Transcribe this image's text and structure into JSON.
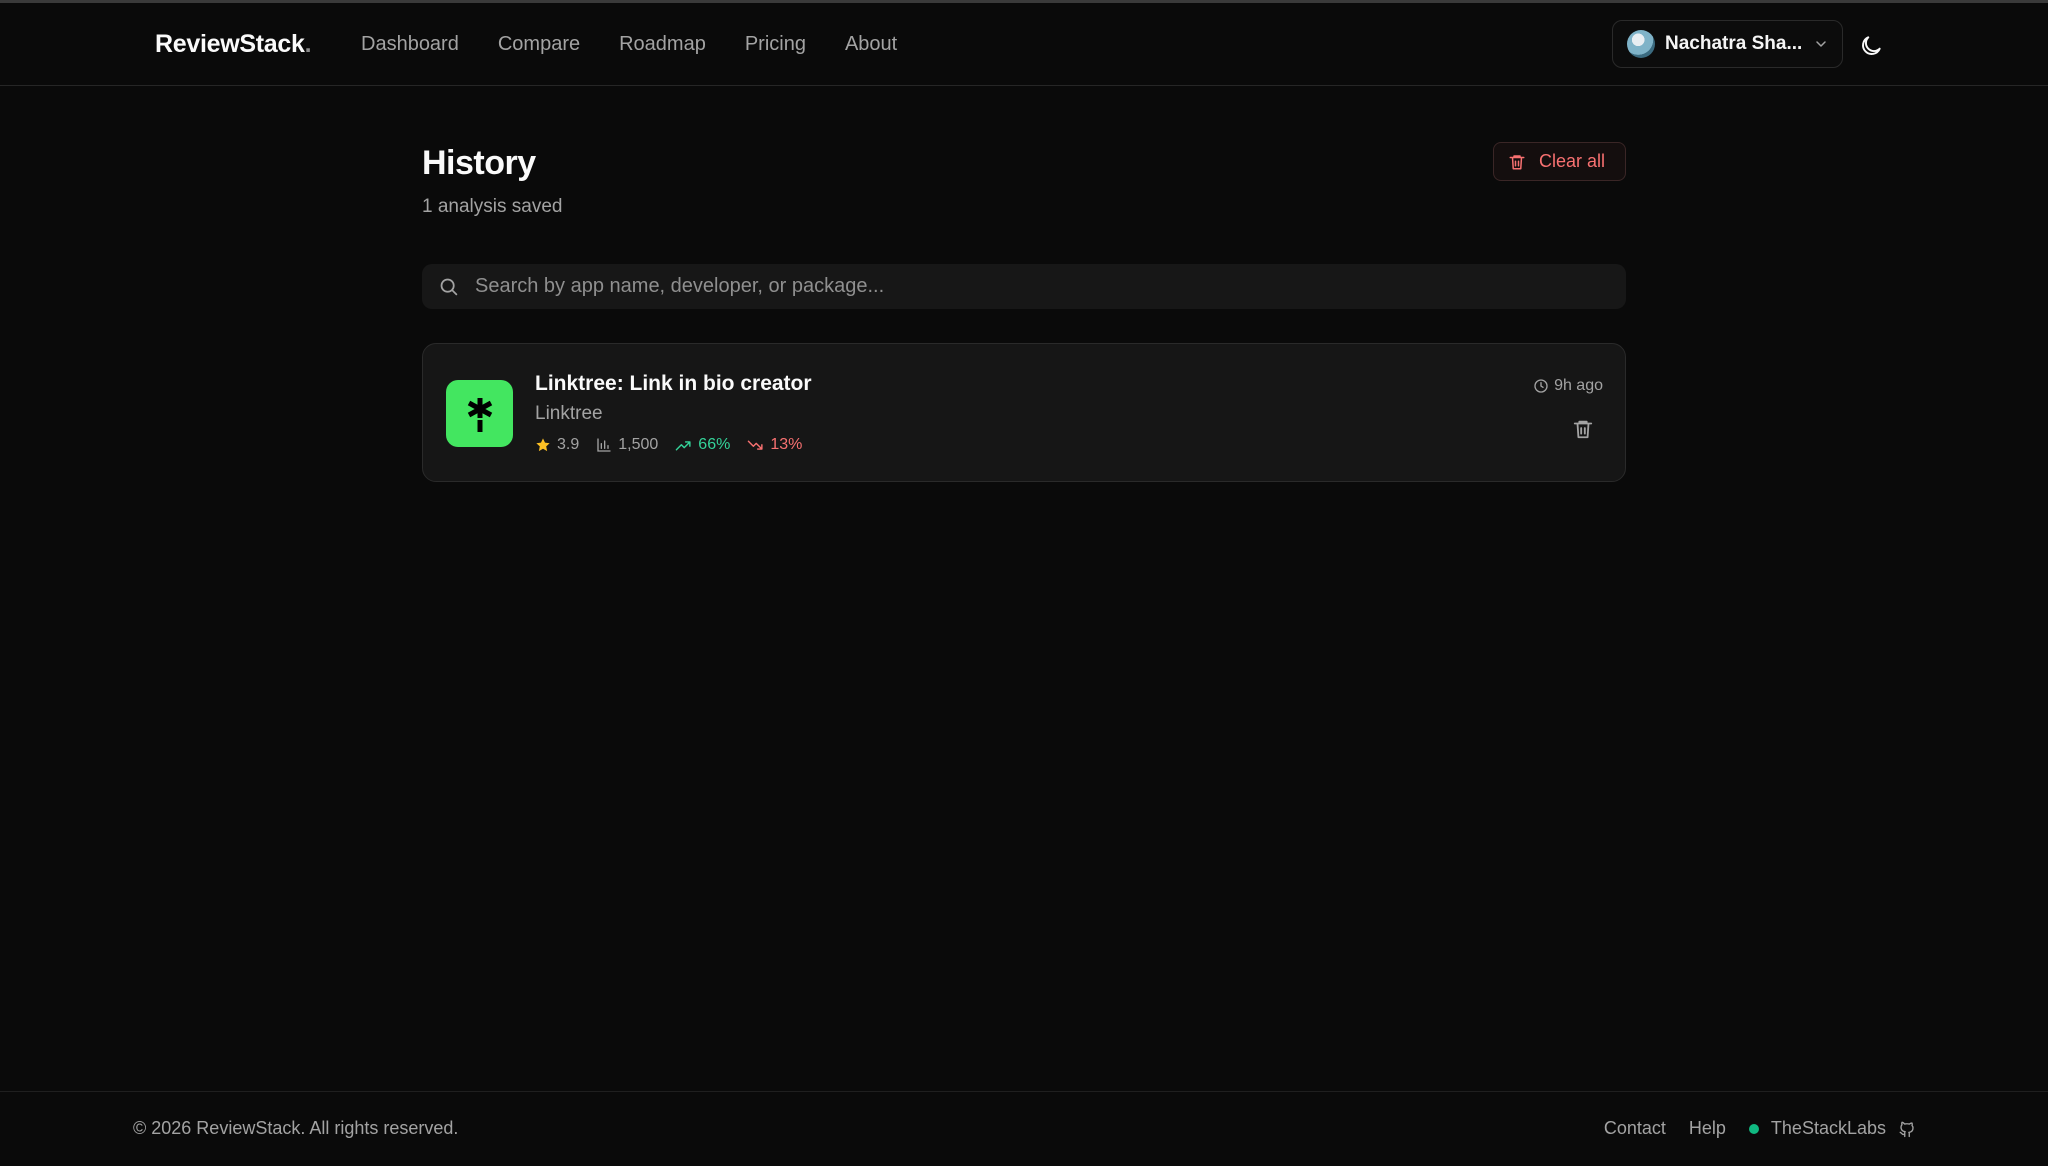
{
  "header": {
    "brand": "ReviewStack",
    "brand_dot": ".",
    "nav": [
      "Dashboard",
      "Compare",
      "Roadmap",
      "Pricing",
      "About"
    ],
    "user_name": "Nachatra Sha..."
  },
  "page": {
    "title": "History",
    "subtitle": "1 analysis saved",
    "clear_label": "Clear all",
    "search_placeholder": "Search by app name, developer, or package..."
  },
  "history": [
    {
      "title": "Linktree: Link in bio creator",
      "developer": "Linktree",
      "rating": "3.9",
      "reviews": "1,500",
      "positive": "66%",
      "negative": "13%",
      "time_ago": "9h ago",
      "icon_color": "#43e660"
    }
  ],
  "footer": {
    "copyright": "© 2026 ReviewStack. All rights reserved.",
    "contact": "Contact",
    "help": "Help",
    "labs": "TheStackLabs"
  },
  "colors": {
    "background": "#0a0a0a",
    "accent_positive": "#34d399",
    "accent_negative": "#f87171",
    "status": "#10b981",
    "star": "#fbbf24"
  }
}
